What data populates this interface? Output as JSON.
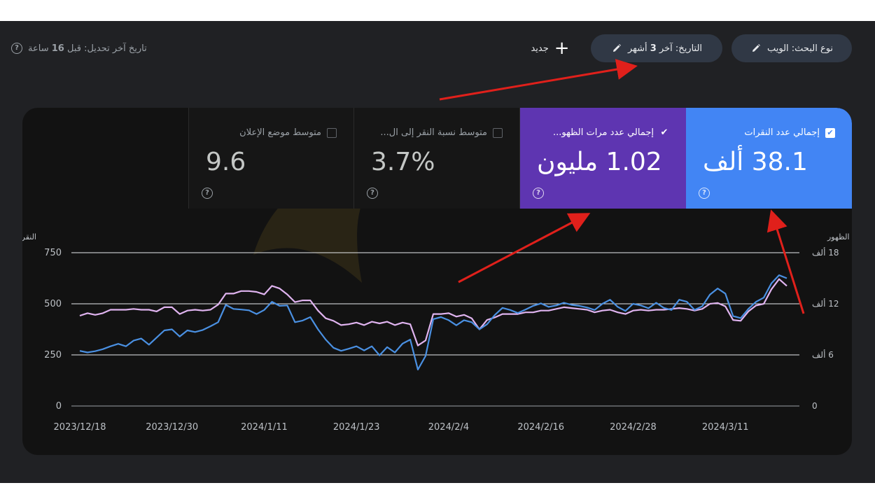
{
  "filters": {
    "search_type_label": "نوع البحث:",
    "search_type_value": "الويب",
    "date_label": "التاريخ:",
    "date_value_pre": "آخر",
    "date_value_num": "3",
    "date_value_post": "أشهر",
    "new_label": "جديد"
  },
  "last_updated": {
    "prefix": "تاريخ آخر تحديل: قبل",
    "count": "16",
    "suffix": "ساعة"
  },
  "metrics": [
    {
      "label": "إجمالي عدد النقرات",
      "value": "38.1 ألف",
      "checked": true
    },
    {
      "label": "إجمالي عدد مرات الظهو...",
      "value": "1.02 مليون",
      "checked": true
    },
    {
      "label": "متوسط نسبة النقر إلى ال...",
      "value": "3.7%",
      "checked": false
    },
    {
      "label": "متوسط موضع الإعلان",
      "value": "9.6",
      "checked": false
    }
  ],
  "colors": {
    "clicks": "#4285f4",
    "impressions": "#5e35b1",
    "clicks_line": "#4a90e2",
    "impressions_line": "#e0b4f0"
  },
  "chart_data": {
    "type": "line",
    "ylabel_left": "النقرات",
    "ylabel_right": "عدد الظهور",
    "yticks_left": [
      "0",
      "250",
      "500",
      "750"
    ],
    "yticks_right": [
      "0",
      "6 ألف",
      "12 ألف",
      "18 ألف"
    ],
    "ylim_left": [
      0,
      750
    ],
    "ylim_right": [
      0,
      18000
    ],
    "x_ticks": [
      "2023/12/18",
      "2023/12/30",
      "2024/1/11",
      "2024/1/23",
      "2024/2/4",
      "2024/2/16",
      "2024/2/28",
      "2024/3/11"
    ],
    "grid": true,
    "series": [
      {
        "name": "النقرات",
        "axis": "left",
        "values": [
          270,
          262,
          268,
          278,
          292,
          304,
          292,
          320,
          330,
          300,
          335,
          370,
          375,
          340,
          370,
          362,
          372,
          390,
          410,
          495,
          475,
          472,
          468,
          450,
          470,
          510,
          490,
          492,
          410,
          418,
          435,
          375,
          325,
          285,
          270,
          280,
          292,
          272,
          292,
          248,
          288,
          262,
          305,
          325,
          178,
          245,
          425,
          435,
          420,
          395,
          420,
          410,
          375,
          400,
          445,
          480,
          470,
          455,
          472,
          490,
          502,
          485,
          492,
          505,
          495,
          490,
          482,
          470,
          500,
          520,
          485,
          465,
          500,
          492,
          478,
          505,
          480,
          470,
          520,
          510,
          470,
          488,
          545,
          575,
          550,
          440,
          430,
          475,
          510,
          530,
          600,
          640,
          625
        ]
      },
      {
        "name": "عدد الظهور",
        "axis": "right",
        "values": [
          10600,
          10900,
          10700,
          10900,
          11300,
          11300,
          11300,
          11400,
          11300,
          11300,
          11100,
          11600,
          11600,
          10800,
          11200,
          11300,
          11200,
          11300,
          11900,
          13200,
          13200,
          13500,
          13500,
          13400,
          13100,
          14100,
          13800,
          13100,
          12200,
          12400,
          12400,
          11200,
          10300,
          10000,
          9500,
          9600,
          9800,
          9500,
          9900,
          9700,
          9900,
          9500,
          9800,
          9600,
          7100,
          7700,
          10800,
          10800,
          10900,
          10500,
          10700,
          10300,
          9000,
          10100,
          10400,
          10800,
          10800,
          10800,
          11000,
          11000,
          11200,
          11200,
          11400,
          11600,
          11500,
          11400,
          11300,
          11000,
          11200,
          11300,
          11000,
          10800,
          11200,
          11300,
          11200,
          11300,
          11300,
          11400,
          11500,
          11400,
          11200,
          11400,
          12000,
          12100,
          11700,
          10100,
          10000,
          11100,
          11800,
          12000,
          13700,
          14900,
          14100
        ]
      }
    ]
  }
}
